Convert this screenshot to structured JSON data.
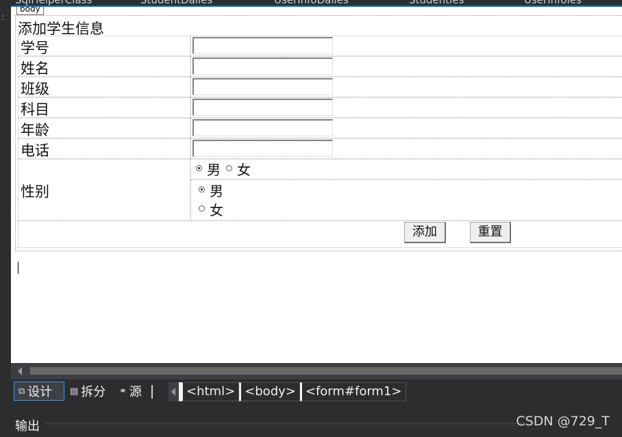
{
  "top_tabs": [
    "SqlHelperClass",
    "StudentDalles",
    "UserInfoDalles",
    "Studenties",
    "UserInfoles"
  ],
  "design": {
    "body_tag": "body",
    "form_title": "添加学生信息",
    "fields": [
      {
        "label": "学号",
        "value": ""
      },
      {
        "label": "姓名",
        "value": ""
      },
      {
        "label": "班级",
        "value": ""
      },
      {
        "label": "科目",
        "value": ""
      },
      {
        "label": "年龄",
        "value": ""
      },
      {
        "label": "电话",
        "value": ""
      }
    ],
    "gender": {
      "label": "性别",
      "inline": {
        "male": "男",
        "female": "女",
        "selected": "male"
      },
      "list": {
        "male": "男",
        "female": "女",
        "selected": "male"
      }
    },
    "buttons": {
      "add": "添加",
      "reset": "重置"
    }
  },
  "viewbar": {
    "design": "设计",
    "split": "拆分",
    "source": "源",
    "crumbs": [
      "<html>",
      "<body>",
      "<form#form1>"
    ]
  },
  "output": {
    "title": "输出",
    "watermark": "CSDN @729_T"
  }
}
